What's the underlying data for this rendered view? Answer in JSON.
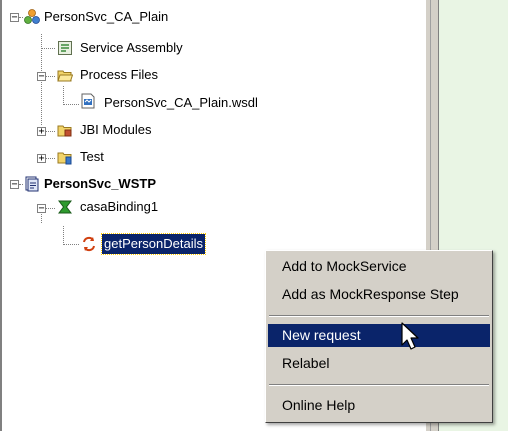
{
  "tree": {
    "items": [
      {
        "label": "PersonSvc_CA_Plain",
        "icon": "composite-app-icon",
        "expander": "−"
      },
      {
        "label": "Service Assembly",
        "icon": "service-assembly-icon"
      },
      {
        "label": "Process Files",
        "icon": "folder-open-icon",
        "expander": "−"
      },
      {
        "label": "PersonSvc_CA_Plain.wsdl",
        "icon": "wsdl-file-icon"
      },
      {
        "label": "JBI Modules",
        "icon": "jbi-modules-folder-icon",
        "expander": "+"
      },
      {
        "label": "Test",
        "icon": "test-folder-icon",
        "expander": "+"
      },
      {
        "label": "PersonSvc_WSTP",
        "icon": "project-icon",
        "expander": "−"
      },
      {
        "label": "casaBinding1",
        "icon": "binding-icon",
        "expander": "−"
      },
      {
        "label": "getPersonDetails",
        "icon": "operation-icon"
      }
    ]
  },
  "context_menu": {
    "items": [
      {
        "label": "Add to MockService"
      },
      {
        "label": "Add as MockResponse Step"
      },
      {
        "label": "New request"
      },
      {
        "label": "Relabel"
      },
      {
        "label": "Online Help"
      }
    ],
    "highlighted": "New request"
  },
  "colors": {
    "selection": "#0a246a",
    "menu_background": "#d4d0c8",
    "right_panel": "#e9f5e4"
  }
}
